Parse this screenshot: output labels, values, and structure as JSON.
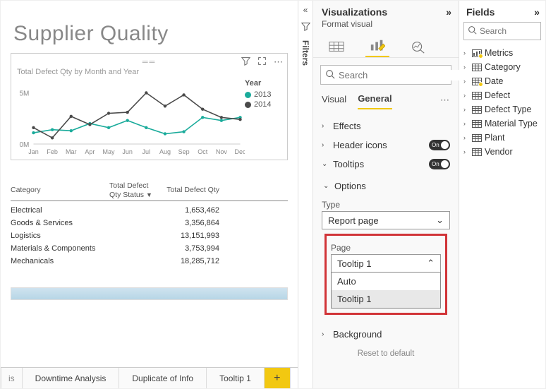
{
  "title": "Supplier Quality",
  "chart": {
    "caption": "Total Defect Qty by Month and Year",
    "legend_title": "Year",
    "legend": [
      {
        "label": "2013",
        "color": "#1aab9b"
      },
      {
        "label": "2014",
        "color": "#4a4a4a"
      }
    ],
    "y_ticks": [
      "5M",
      "0M"
    ],
    "x_ticks": [
      "Jan",
      "Feb",
      "Mar",
      "Apr",
      "May",
      "Jun",
      "Jul",
      "Aug",
      "Sep",
      "Oct",
      "Nov",
      "Dec"
    ]
  },
  "chart_data": {
    "type": "line",
    "categories": [
      "Jan",
      "Feb",
      "Mar",
      "Apr",
      "May",
      "Jun",
      "Jul",
      "Aug",
      "Sep",
      "Oct",
      "Nov",
      "Dec"
    ],
    "series": [
      {
        "name": "2013",
        "color": "#1aab9b",
        "values": [
          1.1,
          1.4,
          1.3,
          2.0,
          1.6,
          2.3,
          1.6,
          1.0,
          1.2,
          2.6,
          2.3,
          2.6
        ]
      },
      {
        "name": "2014",
        "color": "#4a4a4a",
        "values": [
          1.6,
          0.6,
          2.7,
          1.9,
          3.0,
          3.1,
          5.0,
          3.7,
          4.8,
          3.4,
          2.6,
          2.4
        ]
      }
    ],
    "ylabel": "",
    "ylim": [
      0,
      6
    ],
    "yticks": [
      0,
      5
    ],
    "ytick_labels": [
      "0M",
      "5M"
    ]
  },
  "table": {
    "headers": {
      "c1": "Category",
      "c2": "Total Defect Qty Status",
      "c3": "Total Defect Qty"
    },
    "rows": [
      {
        "cat": "Electrical",
        "qty": "1,653,462"
      },
      {
        "cat": "Goods & Services",
        "qty": "3,356,864"
      },
      {
        "cat": "Logistics",
        "qty": "13,151,993"
      },
      {
        "cat": "Materials & Components",
        "qty": "3,753,994"
      },
      {
        "cat": "Mechanicals",
        "qty": "18,285,712"
      }
    ]
  },
  "tabs": {
    "t0": "is",
    "t1": "Downtime Analysis",
    "t2": "Duplicate of Info",
    "t3": "Tooltip 1",
    "add": "+"
  },
  "filters_label": "Filters",
  "vis": {
    "title": "Visualizations",
    "subtitle": "Format visual",
    "search_ph": "Search",
    "subtabs": {
      "visual": "Visual",
      "general": "General"
    },
    "sections": {
      "effects": "Effects",
      "header": "Header icons",
      "tooltips": "Tooltips",
      "options": "Options",
      "background": "Background"
    },
    "toggle_on": "On",
    "type_label": "Type",
    "type_value": "Report page",
    "page_label": "Page",
    "page_value": "Tooltip 1",
    "dd_items": {
      "auto": "Auto",
      "t1": "Tooltip 1"
    },
    "reset": "Reset to default"
  },
  "fields": {
    "title": "Fields",
    "search_ph": "Search",
    "items": [
      {
        "name": "Metrics",
        "badged": true,
        "icon": "measure"
      },
      {
        "name": "Category",
        "badged": false,
        "icon": "table"
      },
      {
        "name": "Date",
        "badged": true,
        "icon": "table"
      },
      {
        "name": "Defect",
        "badged": false,
        "icon": "table"
      },
      {
        "name": "Defect Type",
        "badged": false,
        "icon": "table"
      },
      {
        "name": "Material Type",
        "badged": false,
        "icon": "table"
      },
      {
        "name": "Plant",
        "badged": false,
        "icon": "table"
      },
      {
        "name": "Vendor",
        "badged": false,
        "icon": "table"
      }
    ]
  }
}
